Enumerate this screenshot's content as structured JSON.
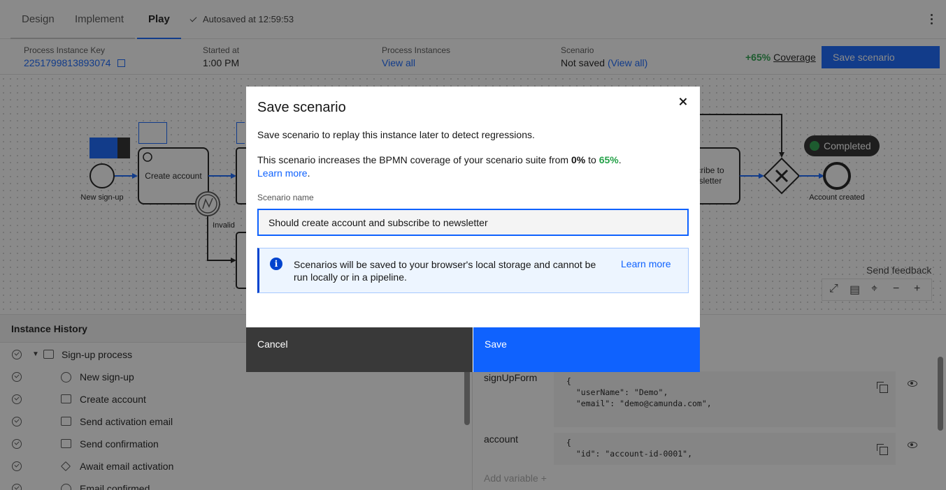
{
  "tabs": [
    {
      "label": "Design"
    },
    {
      "label": "Implement"
    },
    {
      "label": "Play"
    }
  ],
  "autosave": "Autosaved at 12:59:53",
  "info": {
    "instance_key_label": "Process Instance Key",
    "instance_key": "2251799813893074",
    "started_label": "Started at",
    "started": "1:00 PM",
    "instances_label": "Process Instances",
    "instances_link": "View all",
    "scenario_label": "Scenario",
    "scenario_value": "Not saved",
    "scenario_link": "(View all)",
    "coverage_pct": "+65%",
    "coverage_label": "Coverage",
    "save_scenario": "Save scenario"
  },
  "diagram": {
    "start_label": "New sign-up",
    "task1": "Create account",
    "boundary_label": "Invalid",
    "task_right": "cribe to\nsletter",
    "end_label": "Account created",
    "completed": "Completed",
    "feedback": "Send feedback"
  },
  "history": {
    "title": "Instance History",
    "items": [
      {
        "label": "Sign-up process"
      },
      {
        "label": "New sign-up"
      },
      {
        "label": "Create account"
      },
      {
        "label": "Send activation email"
      },
      {
        "label": "Send confirmation"
      },
      {
        "label": "Await email activation"
      },
      {
        "label": "Email confirmed"
      }
    ]
  },
  "variables": {
    "items": [
      {
        "name": "signUpForm",
        "value": "{\n  \"userName\": \"Demo\",\n  \"email\": \"demo@camunda.com\","
      },
      {
        "name": "account",
        "value": "{\n  \"id\": \"account-id-0001\","
      }
    ],
    "add_label": "Add variable"
  },
  "modal": {
    "title": "Save scenario",
    "intro": "Save scenario to replay this instance later to detect regressions.",
    "coverage_text_1": "This scenario increases the BPMN coverage of your scenario suite from",
    "coverage_from": "0%",
    "coverage_to_word": "to",
    "coverage_to": "65%",
    "learn_more": "Learn more",
    "field_label": "Scenario name",
    "field_value": "Should create account and subscribe to newsletter",
    "notice_text": "Scenarios will be saved to your browser's local storage and cannot be run locally or in a pipeline.",
    "notice_link": "Learn more",
    "cancel": "Cancel",
    "save": "Save"
  },
  "colors": {
    "primary": "#0f62fe",
    "success": "#24a148",
    "cancel_bg": "#393939"
  }
}
